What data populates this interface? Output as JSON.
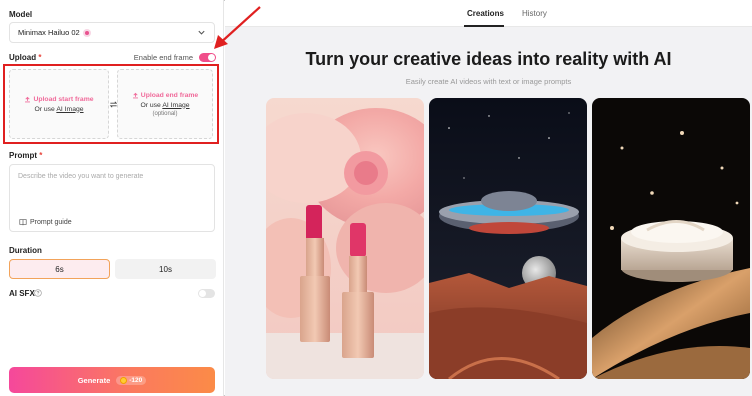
{
  "model": {
    "label": "Model",
    "selected": "Minimax Hailuo 02"
  },
  "upload": {
    "label": "Upload",
    "required_mark": "*",
    "end_frame_toggle_label": "Enable end frame",
    "end_frame_enabled": true,
    "start_title": "Upload start frame",
    "start_sub_prefix": "Or use",
    "start_sub_link": "AI Image",
    "end_title": "Upload end frame",
    "end_sub_prefix": "Or use",
    "end_sub_link": "AI Image",
    "end_optional": "(optional)"
  },
  "prompt": {
    "label": "Prompt",
    "required_mark": "*",
    "placeholder": "Describe the video you want to generate",
    "guide_label": "Prompt guide"
  },
  "duration": {
    "label": "Duration",
    "options": [
      "6s",
      "10s"
    ],
    "selected": "6s"
  },
  "sfx": {
    "label": "AI SFX",
    "enabled": false
  },
  "generate": {
    "label": "Generate",
    "credits": "-120"
  },
  "tabs": {
    "creations": "Creations",
    "history": "History",
    "active": "Creations"
  },
  "hero": {
    "title": "Turn your creative ideas into reality with AI",
    "subtitle": "Easily create AI videos with text or image prompts"
  },
  "gallery": [
    {
      "name": "lipsticks-peony"
    },
    {
      "name": "ufo-desert"
    },
    {
      "name": "cream-jar"
    }
  ],
  "colors": {
    "accent": "#f04e8a",
    "annotation": "#e02020"
  }
}
